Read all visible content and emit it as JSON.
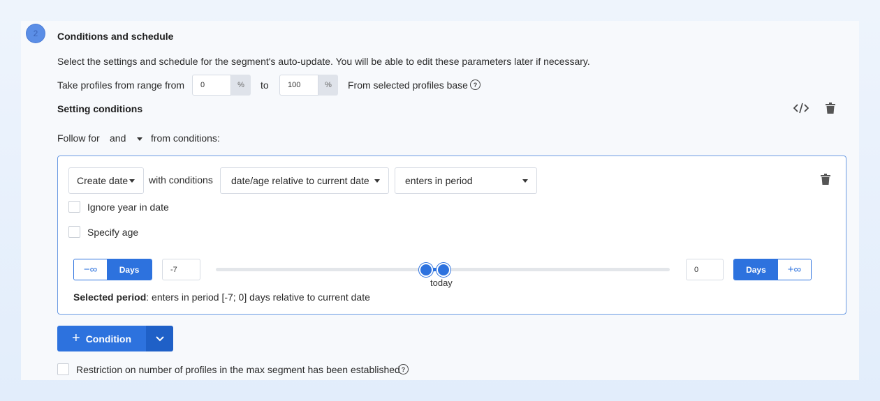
{
  "section": {
    "step_number": "2",
    "title": "Conditions and schedule",
    "description": "Select the settings and schedule for the segment's auto-update. You will be able to edit these parameters later if necessary."
  },
  "range": {
    "label_from": "Take profiles from range from",
    "from_value": "0",
    "from_unit": "%",
    "label_to": "to",
    "to_value": "100",
    "to_unit": "%",
    "suffix": "From selected profiles base",
    "help_icon": "question-circle-icon"
  },
  "conditions": {
    "heading": "Setting conditions",
    "code_icon": "code-icon",
    "delete_icon": "trash-icon",
    "follow_label": "Follow for",
    "operator": "and",
    "follow_suffix": "from conditions:"
  },
  "condition_row": {
    "field": "Create date",
    "with_label": "with conditions",
    "relation": "date/age relative to current date",
    "period_mode": "enters in period",
    "ignore_year_label": "Ignore year in date",
    "ignore_year_checked": false,
    "specify_age_label": "Specify age",
    "specify_age_checked": false,
    "left_infinity": "−∞",
    "left_unit": "Days",
    "left_value": "-7",
    "right_value": "0",
    "right_unit": "Days",
    "right_infinity": "+∞",
    "slider_label": "today",
    "selected_period_label": "Selected period",
    "selected_period_text": ": enters in period [-7; 0] days relative to current date"
  },
  "actions": {
    "add_condition_label": "Condition",
    "add_condition_icon": "plus-icon",
    "dropdown_icon": "chevron-down-icon"
  },
  "restriction": {
    "label": "Restriction on number of profiles in the max segment has been established",
    "checked": false
  },
  "colors": {
    "accent": "#2d72de",
    "box_border": "#6b9be3",
    "background": "#f7f9fc"
  }
}
